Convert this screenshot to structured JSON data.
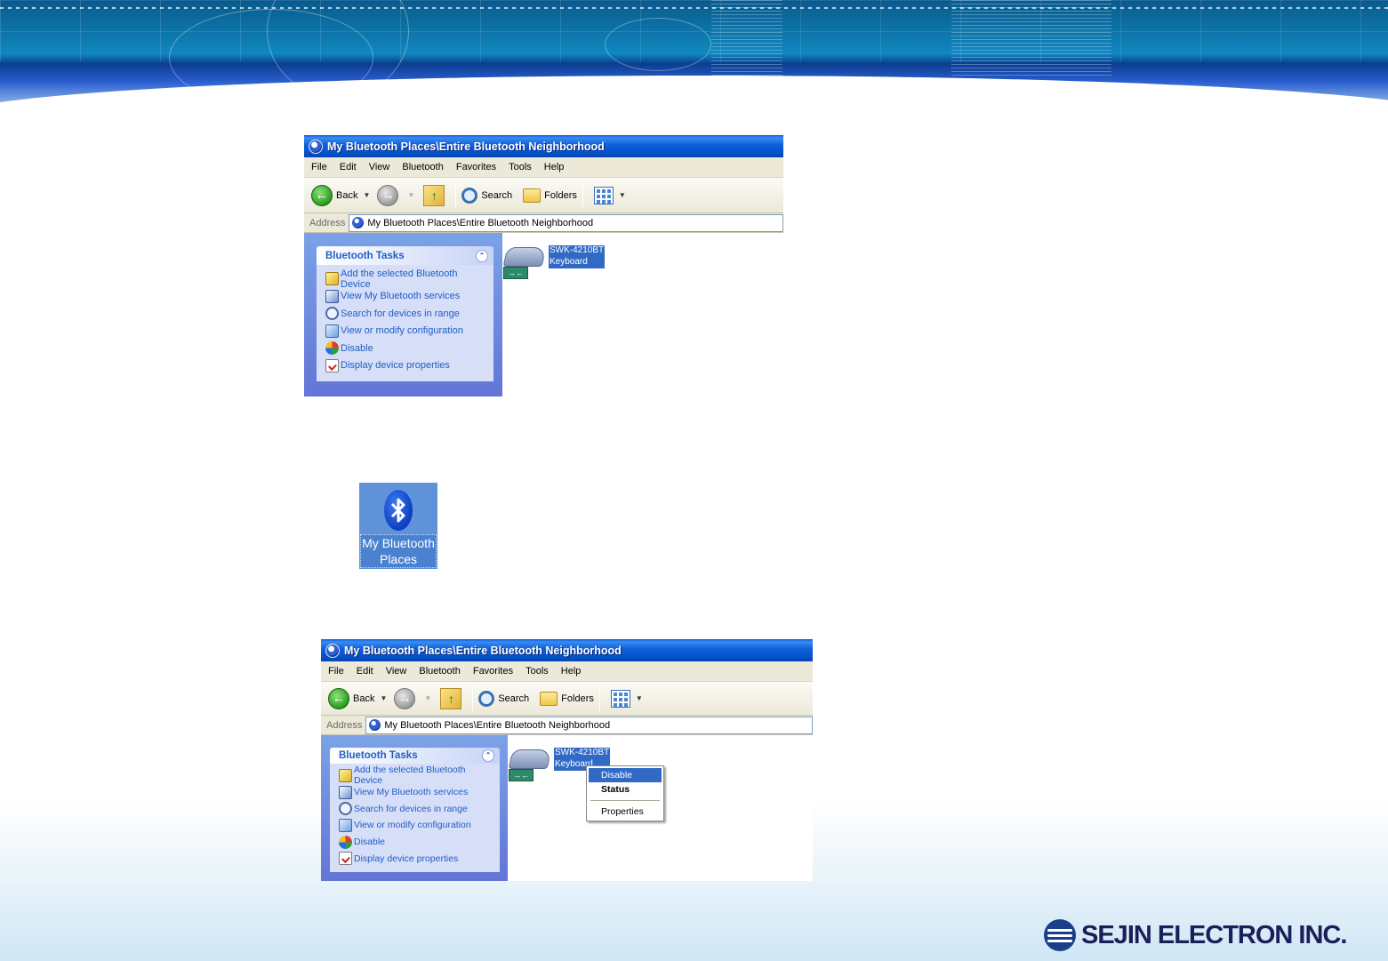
{
  "colors": {
    "title_bar": "#0551c9",
    "task_pane": "#6375d6",
    "link_blue": "#215dc6",
    "selection": "#316ac5",
    "brand": "#1a1f5a"
  },
  "window1": {
    "title": "My Bluetooth Places\\Entire Bluetooth Neighborhood",
    "menu": [
      "File",
      "Edit",
      "View",
      "Bluetooth",
      "Favorites",
      "Tools",
      "Help"
    ],
    "toolbar": {
      "back_label": "Back",
      "search_label": "Search",
      "folders_label": "Folders"
    },
    "address": {
      "label": "Address",
      "value": "My Bluetooth Places\\Entire Bluetooth Neighborhood"
    },
    "tasks": {
      "title": "Bluetooth Tasks",
      "items": [
        {
          "label": "Add the selected Bluetooth Device",
          "icon": "bluetooth-add-icon"
        },
        {
          "label": "View My Bluetooth services",
          "icon": "computer-services-icon"
        },
        {
          "label": "Search for devices in range",
          "icon": "search-icon"
        },
        {
          "label": "View or modify configuration",
          "icon": "configuration-icon"
        },
        {
          "label": "Disable",
          "icon": "disable-icon"
        },
        {
          "label": "Display device properties",
          "icon": "properties-icon"
        }
      ]
    },
    "device": {
      "name": "SWK-4210BT",
      "type": "Keyboard",
      "icon": "keyboard-icon"
    }
  },
  "desktop_icon": {
    "label_line1": "My Bluetooth",
    "label_line2": "Places",
    "icon": "bluetooth-logo-icon"
  },
  "window2": {
    "title": "My Bluetooth Places\\Entire Bluetooth Neighborhood",
    "menu": [
      "File",
      "Edit",
      "View",
      "Bluetooth",
      "Favorites",
      "Tools",
      "Help"
    ],
    "toolbar": {
      "back_label": "Back",
      "search_label": "Search",
      "folders_label": "Folders"
    },
    "address": {
      "label": "Address",
      "value": "My Bluetooth Places\\Entire Bluetooth Neighborhood"
    },
    "tasks": {
      "title": "Bluetooth Tasks",
      "items": [
        {
          "label": "Add the selected Bluetooth Device",
          "icon": "bluetooth-add-icon"
        },
        {
          "label": "View My Bluetooth services",
          "icon": "computer-services-icon"
        },
        {
          "label": "Search for devices in range",
          "icon": "search-icon"
        },
        {
          "label": "View or modify configuration",
          "icon": "configuration-icon"
        },
        {
          "label": "Disable",
          "icon": "disable-icon"
        },
        {
          "label": "Display device properties",
          "icon": "properties-icon"
        }
      ]
    },
    "device": {
      "name": "SWK-4210BT",
      "type": "Keyboard",
      "icon": "keyboard-icon"
    },
    "context_menu": {
      "items": [
        "Disable",
        "Status",
        "Properties"
      ],
      "selected": "Disable"
    }
  },
  "brand": {
    "company": "SEJIN ELECTRON INC."
  }
}
